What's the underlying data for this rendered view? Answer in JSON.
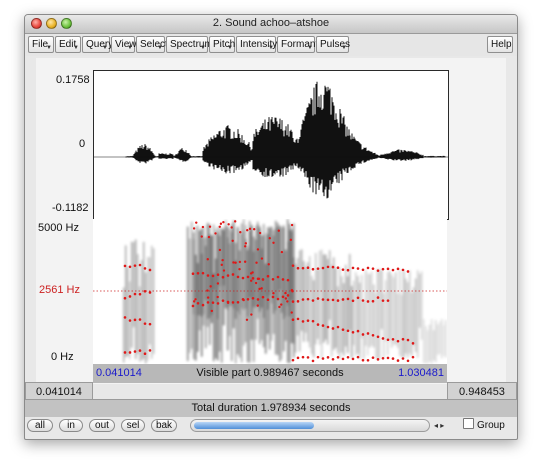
{
  "window": {
    "title": "2. Sound achoo–atshoe"
  },
  "menu": [
    {
      "label": "File"
    },
    {
      "label": "Edit"
    },
    {
      "label": "Query"
    },
    {
      "label": "View"
    },
    {
      "label": "Select"
    },
    {
      "label": "Spectrum"
    },
    {
      "label": "Pitch"
    },
    {
      "label": "Intensity"
    },
    {
      "label": "Formant"
    },
    {
      "label": "Pulses"
    }
  ],
  "help_label": "Help",
  "waveform": {
    "y_max": "0.1758",
    "y_zero": "0",
    "y_min": "-0.1182"
  },
  "spectrogram": {
    "y_top": "5000 Hz",
    "y_cursor": "2561 Hz",
    "y_bottom": "0 Hz"
  },
  "info": {
    "left_time": "0.041014",
    "right_time": "1.030481",
    "visible_part": "Visible part 0.989467 seconds",
    "total_duration": "Total duration 1.978934 seconds",
    "left_box": "0.041014",
    "right_box": "0.948453"
  },
  "buttons": {
    "all": "all",
    "in": "in",
    "out": "out",
    "sel": "sel",
    "bak": "bak"
  },
  "scroll_arrows": "◂ ▸",
  "group_label": "Group",
  "colors": {
    "cursor_red": "#cc2222",
    "blue_time": "#1a1acc",
    "formant_dot": "#e01818"
  }
}
